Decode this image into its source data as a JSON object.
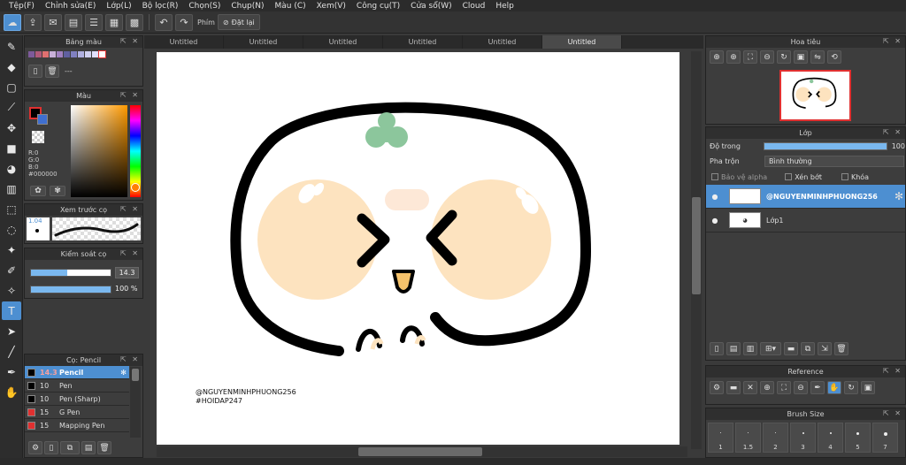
{
  "menu": [
    "Tệp(F)",
    "Chỉnh sửa(E)",
    "Lớp(L)",
    "Bộ lọc(R)",
    "Chọn(S)",
    "Chụp(N)",
    "Màu (C)",
    "Xem(V)",
    "Công cụ(T)",
    "Cửa sổ(W)",
    "Cloud",
    "Help"
  ],
  "toolbar": {
    "hand_label": "Phím",
    "reset_label": "Đặt lại"
  },
  "tabs": [
    "Untitled",
    "Untitled",
    "Untitled",
    "Untitled",
    "Untitled",
    "Untitled"
  ],
  "palette_panel": {
    "title": "Bảng màu",
    "name_text": "---"
  },
  "color_panel": {
    "title": "Màu",
    "r": "R:0",
    "g": "G:0",
    "b": "B:0",
    "hex": "#000000"
  },
  "brush_preview": {
    "title": "Xem trước cọ",
    "size": "1.04"
  },
  "brush_control": {
    "title": "Kiểm soát cọ",
    "size_value": "14.3",
    "opacity_value": "100 %",
    "size_fraction": 0.45,
    "opacity_fraction": 1.0
  },
  "brush_panel": {
    "title": "Cọ: Pencil",
    "items": [
      {
        "size": "14.3",
        "name": "Pencil",
        "color": "#000000",
        "selected": true
      },
      {
        "size": "10",
        "name": "Pen",
        "color": "#000000",
        "selected": false
      },
      {
        "size": "10",
        "name": "Pen (Sharp)",
        "color": "#000000",
        "selected": false
      },
      {
        "size": "15",
        "name": "G Pen",
        "color": "#e03030",
        "selected": false
      },
      {
        "size": "15",
        "name": "Mapping Pen",
        "color": "#e03030",
        "selected": false
      }
    ]
  },
  "canvas": {
    "watermark_line1": "@NGUYENMINHPHUONG256",
    "watermark_line2": "#HOIDAP247"
  },
  "navigator": {
    "title": "Hoa tiêu"
  },
  "layers": {
    "title": "Lớp",
    "opacity_label": "Độ trong",
    "opacity_value": "100",
    "opacity_fraction": 1.0,
    "blend_label": "Pha trộn",
    "blend_value": "Bình thường",
    "protect_alpha": "Bảo vệ alpha",
    "clipping": "Xén bớt",
    "lock": "Khóa",
    "items": [
      {
        "name": "@NGUYENMINHPHUONG256",
        "selected": true
      },
      {
        "name": "Lớp1",
        "selected": false
      }
    ]
  },
  "reference": {
    "title": "Reference"
  },
  "brush_size": {
    "title": "Brush Size",
    "sizes": [
      "1",
      "1.5",
      "2",
      "3",
      "4",
      "5",
      "7"
    ]
  },
  "colors": {
    "accent": "#4d8fd1",
    "panel": "#3d3d3d",
    "face_cheek": "#fde3bf",
    "leaf": "#8cc69c",
    "beak": "#f5c26b"
  }
}
